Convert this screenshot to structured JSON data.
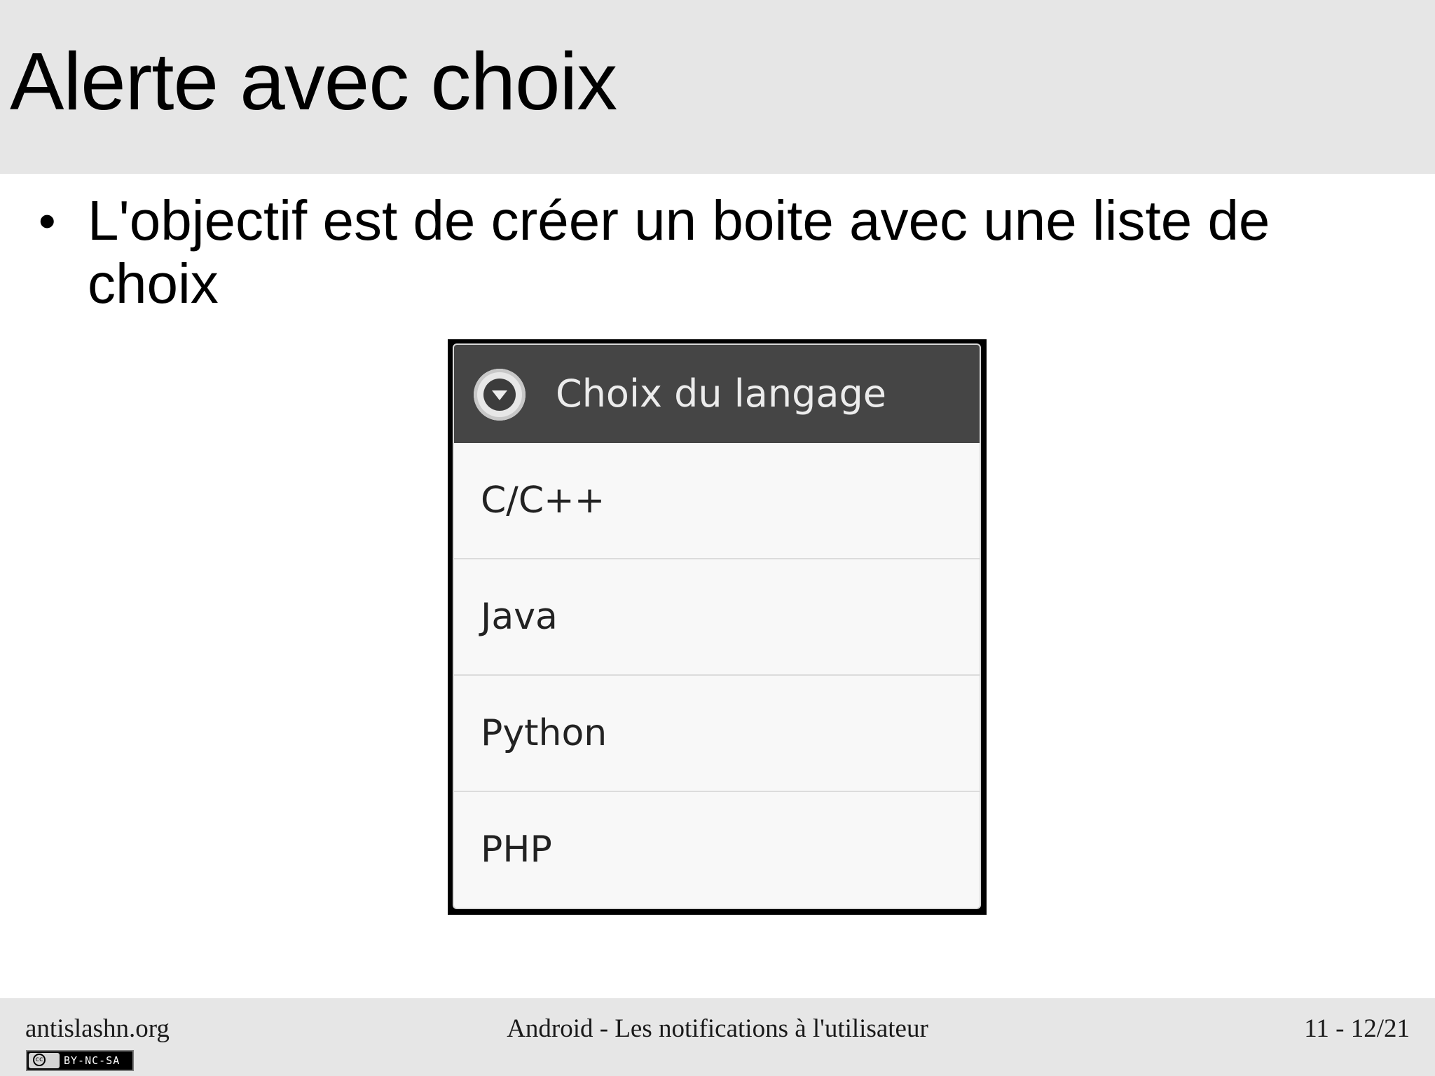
{
  "slide": {
    "title": "Alerte avec choix",
    "bullets": [
      "L'objectif est de créer un boite avec une liste de choix"
    ]
  },
  "dialog": {
    "title": "Choix du langage",
    "icon": "dropdown-circle-icon",
    "options": [
      "C/C++",
      "Java",
      "Python",
      "PHP"
    ]
  },
  "footer": {
    "site": "antislashn.org",
    "course": "Android - Les notifications à l'utilisateur",
    "page": "11 - 12/21",
    "license": "BY-NC-SA",
    "license_logo": "cc"
  },
  "colors": {
    "band": "#e6e6e6",
    "dialog_header": "#454545",
    "dialog_body": "#f8f8f8"
  }
}
